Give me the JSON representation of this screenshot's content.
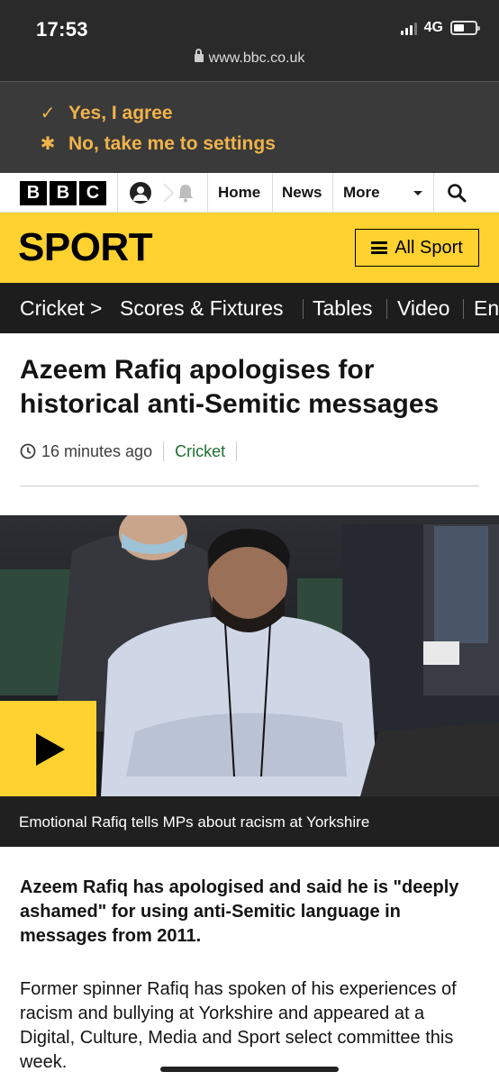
{
  "status_bar": {
    "time": "17:53",
    "network": "4G",
    "url": "www.bbc.co.uk"
  },
  "cookie_banner": {
    "agree_label": "Yes, I agree",
    "settings_label": "No, take me to settings",
    "accent_color": "#f0b34a"
  },
  "masthead": {
    "logo_letters": [
      "B",
      "B",
      "C"
    ],
    "nav": {
      "home": "Home",
      "news": "News",
      "more": "More"
    }
  },
  "sport_bar": {
    "title": "SPORT",
    "all_sport_label": "All Sport",
    "color": "#ffd230"
  },
  "section_nav": {
    "items": [
      "Cricket >",
      "Scores & Fixtures",
      "Tables",
      "Video",
      "En"
    ]
  },
  "article": {
    "headline": "Azeem Rafiq apologises for historical anti-Semitic messages",
    "time_ago": "16 minutes ago",
    "tag": "Cricket",
    "video_caption": "Emotional Rafiq tells MPs about racism at Yorkshire",
    "intro": "Azeem Rafiq has apologised and said he is \"deeply ashamed\" for using anti-Semitic language in messages from 2011.",
    "body": "Former spinner Rafiq has spoken of his experiences of racism and bullying at Yorkshire and appeared at a Digital, Culture, Media and Sport select committee this week."
  }
}
